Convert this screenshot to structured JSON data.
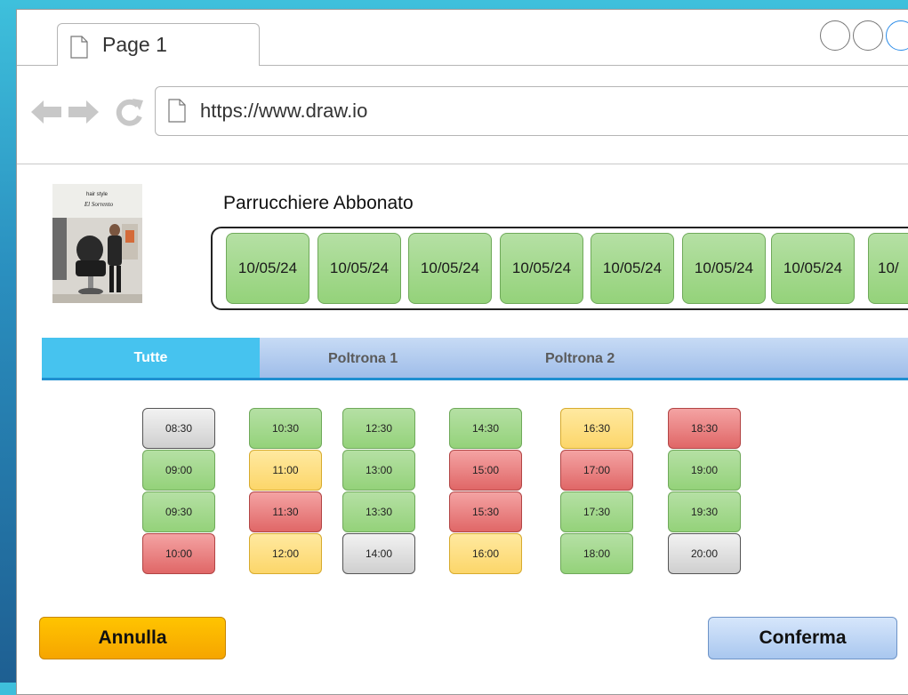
{
  "browser": {
    "tab_label": "Page 1",
    "url": "https://www.draw.io"
  },
  "shop": {
    "name": "Parrucchiere Abbonato",
    "logo_text": "hair style",
    "logo_script": "El Sorrento"
  },
  "dates": [
    "10/05/24",
    "10/05/24",
    "10/05/24",
    "10/05/24",
    "10/05/24",
    "10/05/24",
    "10/05/24",
    "10/"
  ],
  "filter_tabs": [
    {
      "label": "Tutte",
      "active": true
    },
    {
      "label": "Poltrona 1",
      "active": false
    },
    {
      "label": "Poltrona 2",
      "active": false
    }
  ],
  "slot_colors": {
    "gray": "#d9d9d9",
    "green": "#9fd787",
    "yellow": "#fde28a",
    "red": "#eb7f7f"
  },
  "slot_columns": [
    [
      {
        "time": "08:30",
        "status": "gray"
      },
      {
        "time": "09:00",
        "status": "green"
      },
      {
        "time": "09:30",
        "status": "green"
      },
      {
        "time": "10:00",
        "status": "red"
      }
    ],
    [
      {
        "time": "10:30",
        "status": "green"
      },
      {
        "time": "11:00",
        "status": "yellow"
      },
      {
        "time": "11:30",
        "status": "red"
      },
      {
        "time": "12:00",
        "status": "yellow"
      }
    ],
    [
      {
        "time": "12:30",
        "status": "green"
      },
      {
        "time": "13:00",
        "status": "green"
      },
      {
        "time": "13:30",
        "status": "green"
      },
      {
        "time": "14:00",
        "status": "gray"
      }
    ],
    [
      {
        "time": "14:30",
        "status": "green"
      },
      {
        "time": "15:00",
        "status": "red"
      },
      {
        "time": "15:30",
        "status": "red"
      },
      {
        "time": "16:00",
        "status": "yellow"
      }
    ],
    [
      {
        "time": "16:30",
        "status": "yellow"
      },
      {
        "time": "17:00",
        "status": "red"
      },
      {
        "time": "17:30",
        "status": "green"
      },
      {
        "time": "18:00",
        "status": "green"
      }
    ],
    [
      {
        "time": "18:30",
        "status": "red"
      },
      {
        "time": "19:00",
        "status": "green"
      },
      {
        "time": "19:30",
        "status": "green"
      },
      {
        "time": "20:00",
        "status": "gray"
      }
    ]
  ],
  "actions": {
    "cancel_label": "Annulla",
    "confirm_label": "Conferma"
  }
}
